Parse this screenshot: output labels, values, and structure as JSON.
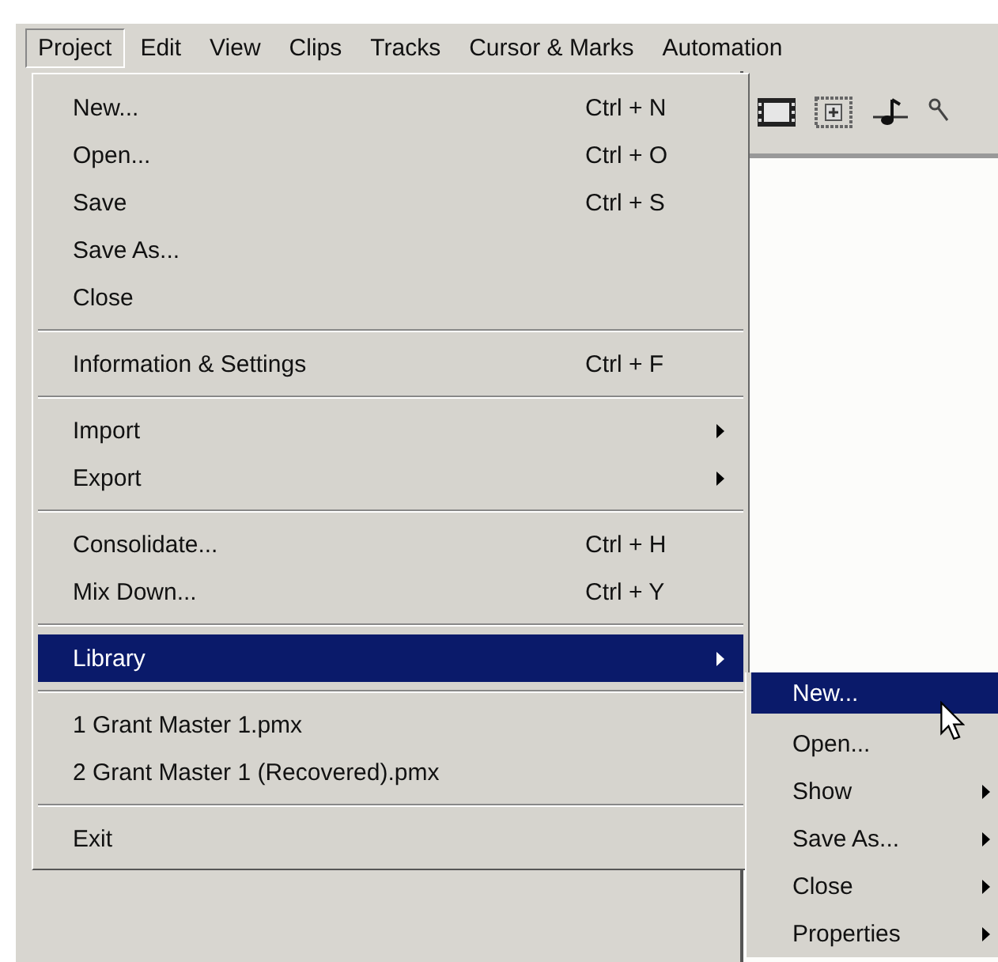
{
  "menubar": [
    {
      "label": "Project",
      "selected": true
    },
    {
      "label": "Edit",
      "selected": false
    },
    {
      "label": "View",
      "selected": false
    },
    {
      "label": "Clips",
      "selected": false
    },
    {
      "label": "Tracks",
      "selected": false
    },
    {
      "label": "Cursor & Marks",
      "selected": false
    },
    {
      "label": "Automation",
      "selected": false
    }
  ],
  "project_menu": [
    {
      "kind": "item",
      "label": "New...",
      "shortcut": "Ctrl + N",
      "submenu": false,
      "selected": false
    },
    {
      "kind": "item",
      "label": "Open...",
      "shortcut": "Ctrl + O",
      "submenu": false,
      "selected": false
    },
    {
      "kind": "item",
      "label": "Save",
      "shortcut": "Ctrl + S",
      "submenu": false,
      "selected": false
    },
    {
      "kind": "item",
      "label": "Save As...",
      "submenu": false,
      "selected": false
    },
    {
      "kind": "item",
      "label": "Close",
      "submenu": false,
      "selected": false
    },
    {
      "kind": "separator"
    },
    {
      "kind": "item",
      "label": "Information & Settings",
      "shortcut": "Ctrl + F",
      "submenu": false,
      "selected": false
    },
    {
      "kind": "separator"
    },
    {
      "kind": "item",
      "label": "Import",
      "submenu": true,
      "selected": false
    },
    {
      "kind": "item",
      "label": "Export",
      "submenu": true,
      "selected": false
    },
    {
      "kind": "separator"
    },
    {
      "kind": "item",
      "label": "Consolidate...",
      "shortcut": "Ctrl + H",
      "submenu": false,
      "selected": false
    },
    {
      "kind": "item",
      "label": "Mix Down...",
      "shortcut": "Ctrl + Y",
      "submenu": false,
      "selected": false
    },
    {
      "kind": "separator"
    },
    {
      "kind": "item",
      "label": "Library",
      "submenu": true,
      "selected": true
    },
    {
      "kind": "separator"
    },
    {
      "kind": "item",
      "label": "1 Grant Master 1.pmx",
      "submenu": false,
      "selected": false
    },
    {
      "kind": "item",
      "label": "2 Grant Master 1 (Recovered).pmx",
      "submenu": false,
      "selected": false
    },
    {
      "kind": "separator"
    },
    {
      "kind": "item",
      "label": "Exit",
      "submenu": false,
      "selected": false
    }
  ],
  "library_submenu": [
    {
      "label": "New...",
      "submenu": false,
      "selected": true
    },
    {
      "label": "Open...",
      "submenu": false,
      "selected": false
    },
    {
      "label": "Show",
      "submenu": true,
      "selected": false
    },
    {
      "label": "Save As...",
      "submenu": true,
      "selected": false
    },
    {
      "label": "Close",
      "submenu": true,
      "selected": false
    },
    {
      "label": "Properties",
      "submenu": true,
      "selected": false
    }
  ]
}
